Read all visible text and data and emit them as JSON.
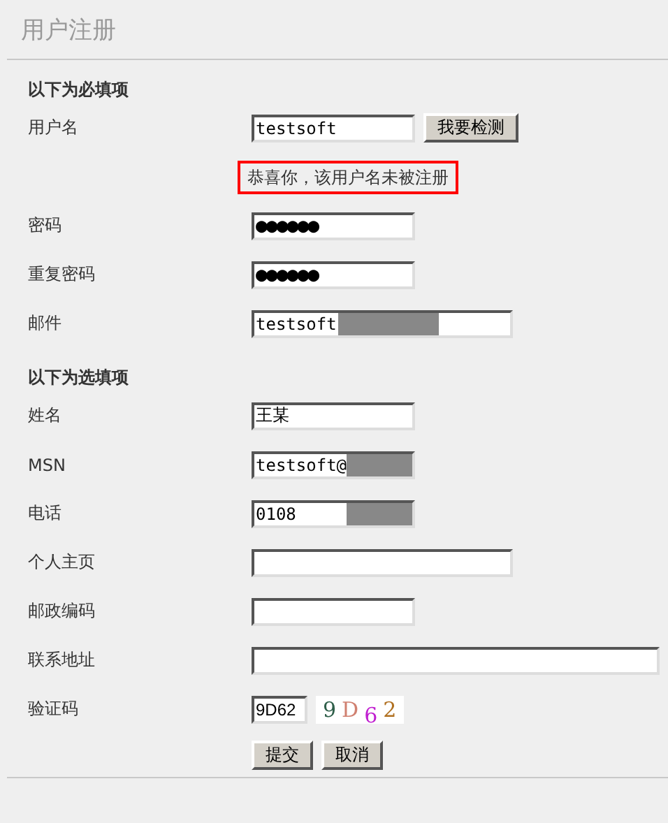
{
  "page": {
    "title": "用户注册"
  },
  "sections": [
    {
      "title": "以下为必填项",
      "rows": [
        {
          "kind": "text",
          "label": "用户名",
          "value": "testsoft",
          "button": "我要检测"
        },
        {
          "kind": "message",
          "text": "恭喜你，该用户名未被注册"
        },
        {
          "kind": "password",
          "label": "密码",
          "value": "●●●●●●"
        },
        {
          "kind": "password",
          "label": "重复密码",
          "value": "●●●●●●"
        },
        {
          "kind": "text",
          "label": "邮件",
          "value": "testsoft",
          "redacted": true
        }
      ]
    },
    {
      "title": "以下为选填项",
      "rows": [
        {
          "kind": "text",
          "label": "姓名",
          "value": "王某"
        },
        {
          "kind": "text",
          "label": "MSN",
          "value": "testsoft@",
          "redacted": true
        },
        {
          "kind": "text",
          "label": "电话",
          "value": "0108",
          "redacted": true
        },
        {
          "kind": "text",
          "label": "个人主页"
        },
        {
          "kind": "text",
          "label": "邮政编码"
        },
        {
          "kind": "text",
          "label": "联系地址"
        },
        {
          "kind": "captcha",
          "label": "验证码",
          "value": "9D62",
          "chars": [
            {
              "text": "9",
              "color": "#2f5f4a"
            },
            {
              "text": "D",
              "color": "#d08070"
            },
            {
              "text": "6",
              "color": "#c020d0"
            },
            {
              "text": "2",
              "color": "#b07020"
            }
          ]
        }
      ]
    }
  ],
  "buttons": [
    "提交",
    "取消"
  ]
}
